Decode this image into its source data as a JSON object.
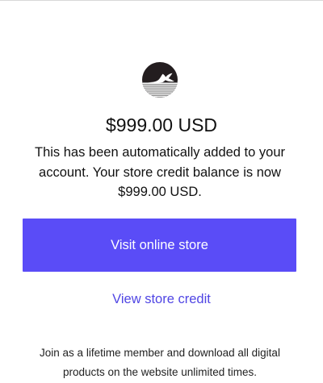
{
  "logo": {
    "icon": "whale-tail-logo-icon",
    "colors": {
      "dark": "#231d1f",
      "light": "#ffffff",
      "stripes": "#8f8f8f"
    }
  },
  "credit": {
    "amount": "$999.00 USD",
    "message": "This has been automatically added to your account. Your store credit balance is now $999.00 USD."
  },
  "actions": {
    "visit_label": "Visit online store",
    "view_credit_label": "View store credit"
  },
  "footer": {
    "text": "Join as a lifetime member and download all digital products on the website unlimited times."
  },
  "colors": {
    "accent": "#5a4cf7",
    "link": "#5046e4",
    "text": "#111111",
    "background": "#ffffff"
  }
}
